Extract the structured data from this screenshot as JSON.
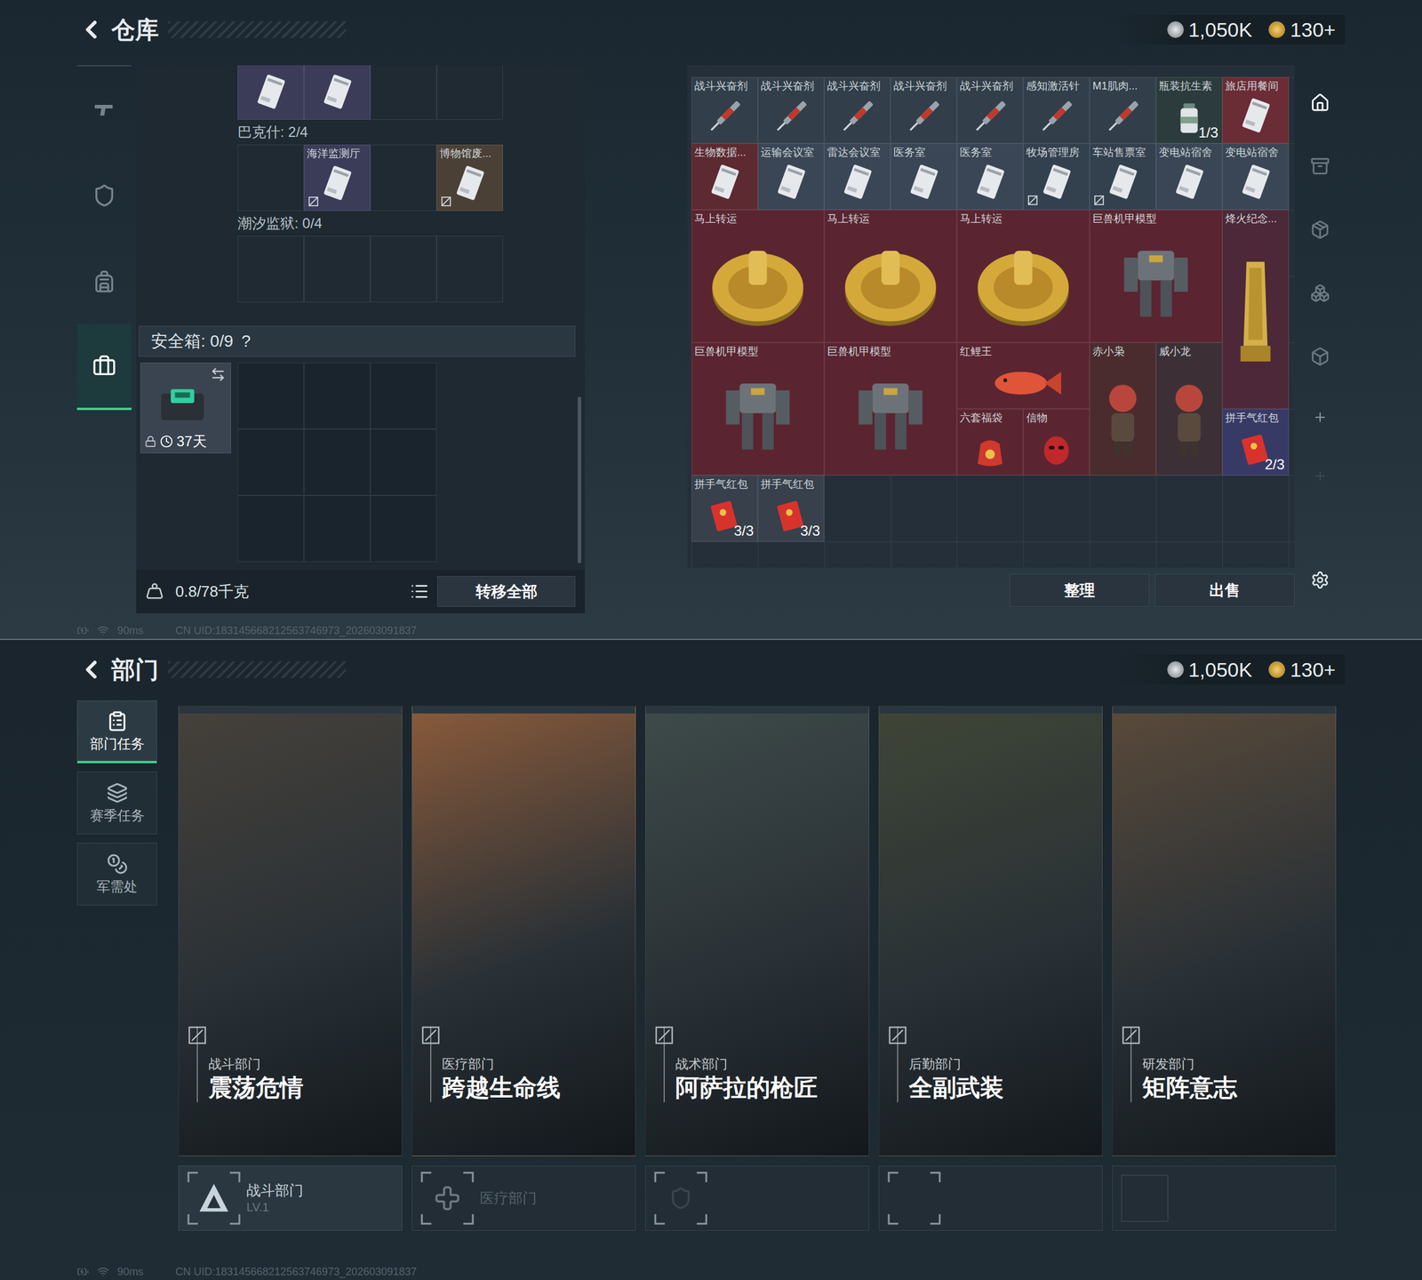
{
  "warehouse": {
    "header": {
      "title": "仓库",
      "currency": [
        {
          "value": "1,050K",
          "kind": "silver"
        },
        {
          "value": "130+",
          "kind": "gold"
        }
      ]
    },
    "nav": [
      {
        "kind": "weapon",
        "selected": false
      },
      {
        "kind": "armor",
        "selected": false
      },
      {
        "kind": "backpack",
        "selected": false
      },
      {
        "kind": "case",
        "selected": true
      }
    ],
    "stash": {
      "groups": [
        {
          "cells": [
            {
              "name": "",
              "kind": "card",
              "color": "#3b3c58",
              "locked": false
            },
            {
              "name": "",
              "kind": "card",
              "color": "#3b3c58",
              "locked": false
            },
            {
              "name": "",
              "kind": "empty",
              "color": "#1f2a33",
              "locked": false
            },
            {
              "name": "",
              "kind": "empty",
              "color": "#1f2a33",
              "locked": false
            }
          ]
        },
        {
          "label": "巴克什: 2/4",
          "cells": [
            {
              "name": "",
              "kind": "empty",
              "color": "#1f2a33",
              "locked": false
            },
            {
              "name": "海洋监测厅",
              "kind": "card",
              "color": "#3b3c58",
              "locked": true
            },
            {
              "name": "",
              "kind": "empty",
              "color": "#1f2a33",
              "locked": false
            },
            {
              "name": "博物馆废...",
              "kind": "card",
              "color": "#4b4036",
              "locked": true
            }
          ]
        },
        {
          "label": "潮汐监狱: 0/4",
          "cells": [
            {
              "name": "",
              "kind": "empty",
              "color": "#1f2a33",
              "locked": false
            },
            {
              "name": "",
              "kind": "empty",
              "color": "#1f2a33",
              "locked": false
            },
            {
              "name": "",
              "kind": "empty",
              "color": "#1f2a33",
              "locked": false
            },
            {
              "name": "",
              "kind": "empty",
              "color": "#1f2a33",
              "locked": false
            }
          ]
        }
      ],
      "safe": {
        "label": "安全箱: 0/9",
        "help": "?",
        "timer": "37天",
        "locked": true,
        "slots": 9
      },
      "footer": {
        "weight": "0.8/78千克",
        "transfer": "转移全部"
      }
    },
    "items": [
      {
        "name": "战斗兴奋剂",
        "kind": "syringe",
        "color": "#323e49",
        "locked": false
      },
      {
        "name": "战斗兴奋剂",
        "kind": "syringe",
        "color": "#323e49",
        "locked": false
      },
      {
        "name": "战斗兴奋剂",
        "kind": "syringe",
        "color": "#323e49",
        "locked": false
      },
      {
        "name": "战斗兴奋剂",
        "kind": "syringe",
        "color": "#323e49",
        "locked": false
      },
      {
        "name": "战斗兴奋剂",
        "kind": "syringe",
        "color": "#323e49",
        "locked": false
      },
      {
        "name": "感知激活针",
        "kind": "syringe",
        "color": "#323e49",
        "locked": false
      },
      {
        "name": "M1肌肉...",
        "kind": "syringe",
        "color": "#323e49",
        "locked": false
      },
      {
        "name": "瓶装抗生素",
        "kind": "bottle",
        "color": "#2c3b3b",
        "locked": false,
        "count": "1/3"
      },
      {
        "name": "旅店用餐间",
        "kind": "card",
        "color": "#6a2c35",
        "locked": false
      },
      {
        "name": "生物数据...",
        "kind": "card",
        "color": "#5e2a31",
        "locked": false
      },
      {
        "name": "运输会议室",
        "kind": "card",
        "color": "#3a4655",
        "locked": false
      },
      {
        "name": "雷达会议室",
        "kind": "card",
        "color": "#3a4655",
        "locked": false
      },
      {
        "name": "医务室",
        "kind": "card",
        "color": "#3a4655",
        "locked": false
      },
      {
        "name": "医务室",
        "kind": "card",
        "color": "#3a4655",
        "locked": false
      },
      {
        "name": "牧场管理房",
        "kind": "card",
        "color": "#33404e",
        "locked": true
      },
      {
        "name": "车站售票室",
        "kind": "card",
        "color": "#33404e",
        "locked": true
      },
      {
        "name": "变电站宿舍",
        "kind": "card",
        "color": "#3a4655",
        "locked": false
      },
      {
        "name": "变电站宿舍",
        "kind": "card",
        "color": "#3a4655",
        "locked": false
      },
      {
        "name": "马上转运",
        "kind": "coin",
        "color": "#5a2530",
        "locked": false
      },
      {
        "name": "马上转运",
        "kind": "coin",
        "color": "#5a2530",
        "locked": false
      },
      {
        "name": "马上转运",
        "kind": "coin",
        "color": "#5a2530",
        "locked": false
      },
      {
        "name": "巨兽机甲模型",
        "kind": "mech",
        "color": "#5a2530",
        "locked": false
      },
      {
        "name": "烽火纪念...",
        "kind": "trophy",
        "color": "#4c2838",
        "locked": false
      },
      {
        "name": "巨兽机甲模型",
        "kind": "mech",
        "color": "#5a2530",
        "locked": false
      },
      {
        "name": "巨兽机甲模型",
        "kind": "mech",
        "color": "#5a2530",
        "locked": false
      },
      {
        "name": "红鲤王",
        "kind": "fish",
        "color": "#5a2530",
        "locked": false
      },
      {
        "name": "赤小枭",
        "kind": "figure",
        "color": "#4a2c2e",
        "locked": false
      },
      {
        "name": "威小龙",
        "kind": "figure",
        "color": "#3c3036",
        "locked": false
      },
      {
        "name": "六套福袋",
        "kind": "bag",
        "color": "#5a2530",
        "locked": false
      },
      {
        "name": "信物",
        "kind": "mask",
        "color": "#5a2530",
        "locked": false
      },
      {
        "name": "拼手气红包",
        "kind": "envelope",
        "color": "#383a66",
        "locked": false,
        "count": "2/3"
      },
      {
        "name": "拼手气红包",
        "kind": "envelope",
        "color": "#37404b",
        "locked": false,
        "count": "3/3"
      },
      {
        "name": "拼手气红包",
        "kind": "envelope",
        "color": "#37404b",
        "locked": false,
        "count": "3/3"
      }
    ],
    "tools": [
      {
        "kind": "stash",
        "selected": true
      },
      {
        "kind": "archive",
        "selected": false
      },
      {
        "kind": "package",
        "selected": false
      },
      {
        "kind": "boxes",
        "selected": false
      },
      {
        "kind": "box",
        "selected": false
      }
    ],
    "addSlots": [
      {
        "disabled": false
      },
      {
        "disabled": true
      }
    ],
    "actions": [
      "整理",
      "出售"
    ],
    "status": {
      "ping": "90ms",
      "uid": "CN UID:183145668212563746973_202603091837"
    }
  },
  "department": {
    "header": {
      "title": "部门",
      "currency": [
        {
          "value": "1,050K",
          "kind": "silver"
        },
        {
          "value": "130+",
          "kind": "gold"
        }
      ]
    },
    "tabs": [
      {
        "label": "部门任务",
        "kind": "tasks",
        "selected": true
      },
      {
        "label": "赛季任务",
        "kind": "season",
        "selected": false
      },
      {
        "label": "军需处",
        "kind": "supply",
        "selected": false
      }
    ],
    "cards": [
      {
        "dept": "战斗部门",
        "title": "震荡危情",
        "color": "#46413a"
      },
      {
        "dept": "医疗部门",
        "title": "跨越生命线",
        "color": "#8a5a3a"
      },
      {
        "dept": "战术部门",
        "title": "阿萨拉的枪匠",
        "color": "#3e4a4a"
      },
      {
        "dept": "后勤部门",
        "title": "全副武装",
        "color": "#3f4636"
      },
      {
        "dept": "研发部门",
        "title": "矩阵意志",
        "color": "#5a4a3a"
      }
    ],
    "strips": [
      {
        "kind": "combat",
        "label": "战斗部门",
        "level": "LV.1",
        "active": true
      },
      {
        "kind": "medical",
        "label": "医疗部门",
        "level": "",
        "active": false
      },
      {
        "kind": "tactical",
        "label": "",
        "level": "",
        "active": false
      },
      {
        "kind": "logistics",
        "label": "",
        "level": "",
        "active": false
      },
      {
        "kind": "research",
        "label": "",
        "level": "",
        "active": false
      }
    ],
    "status": {
      "ping": "90ms",
      "uid": "CN UID:183145668212563746973_202603091837"
    }
  }
}
